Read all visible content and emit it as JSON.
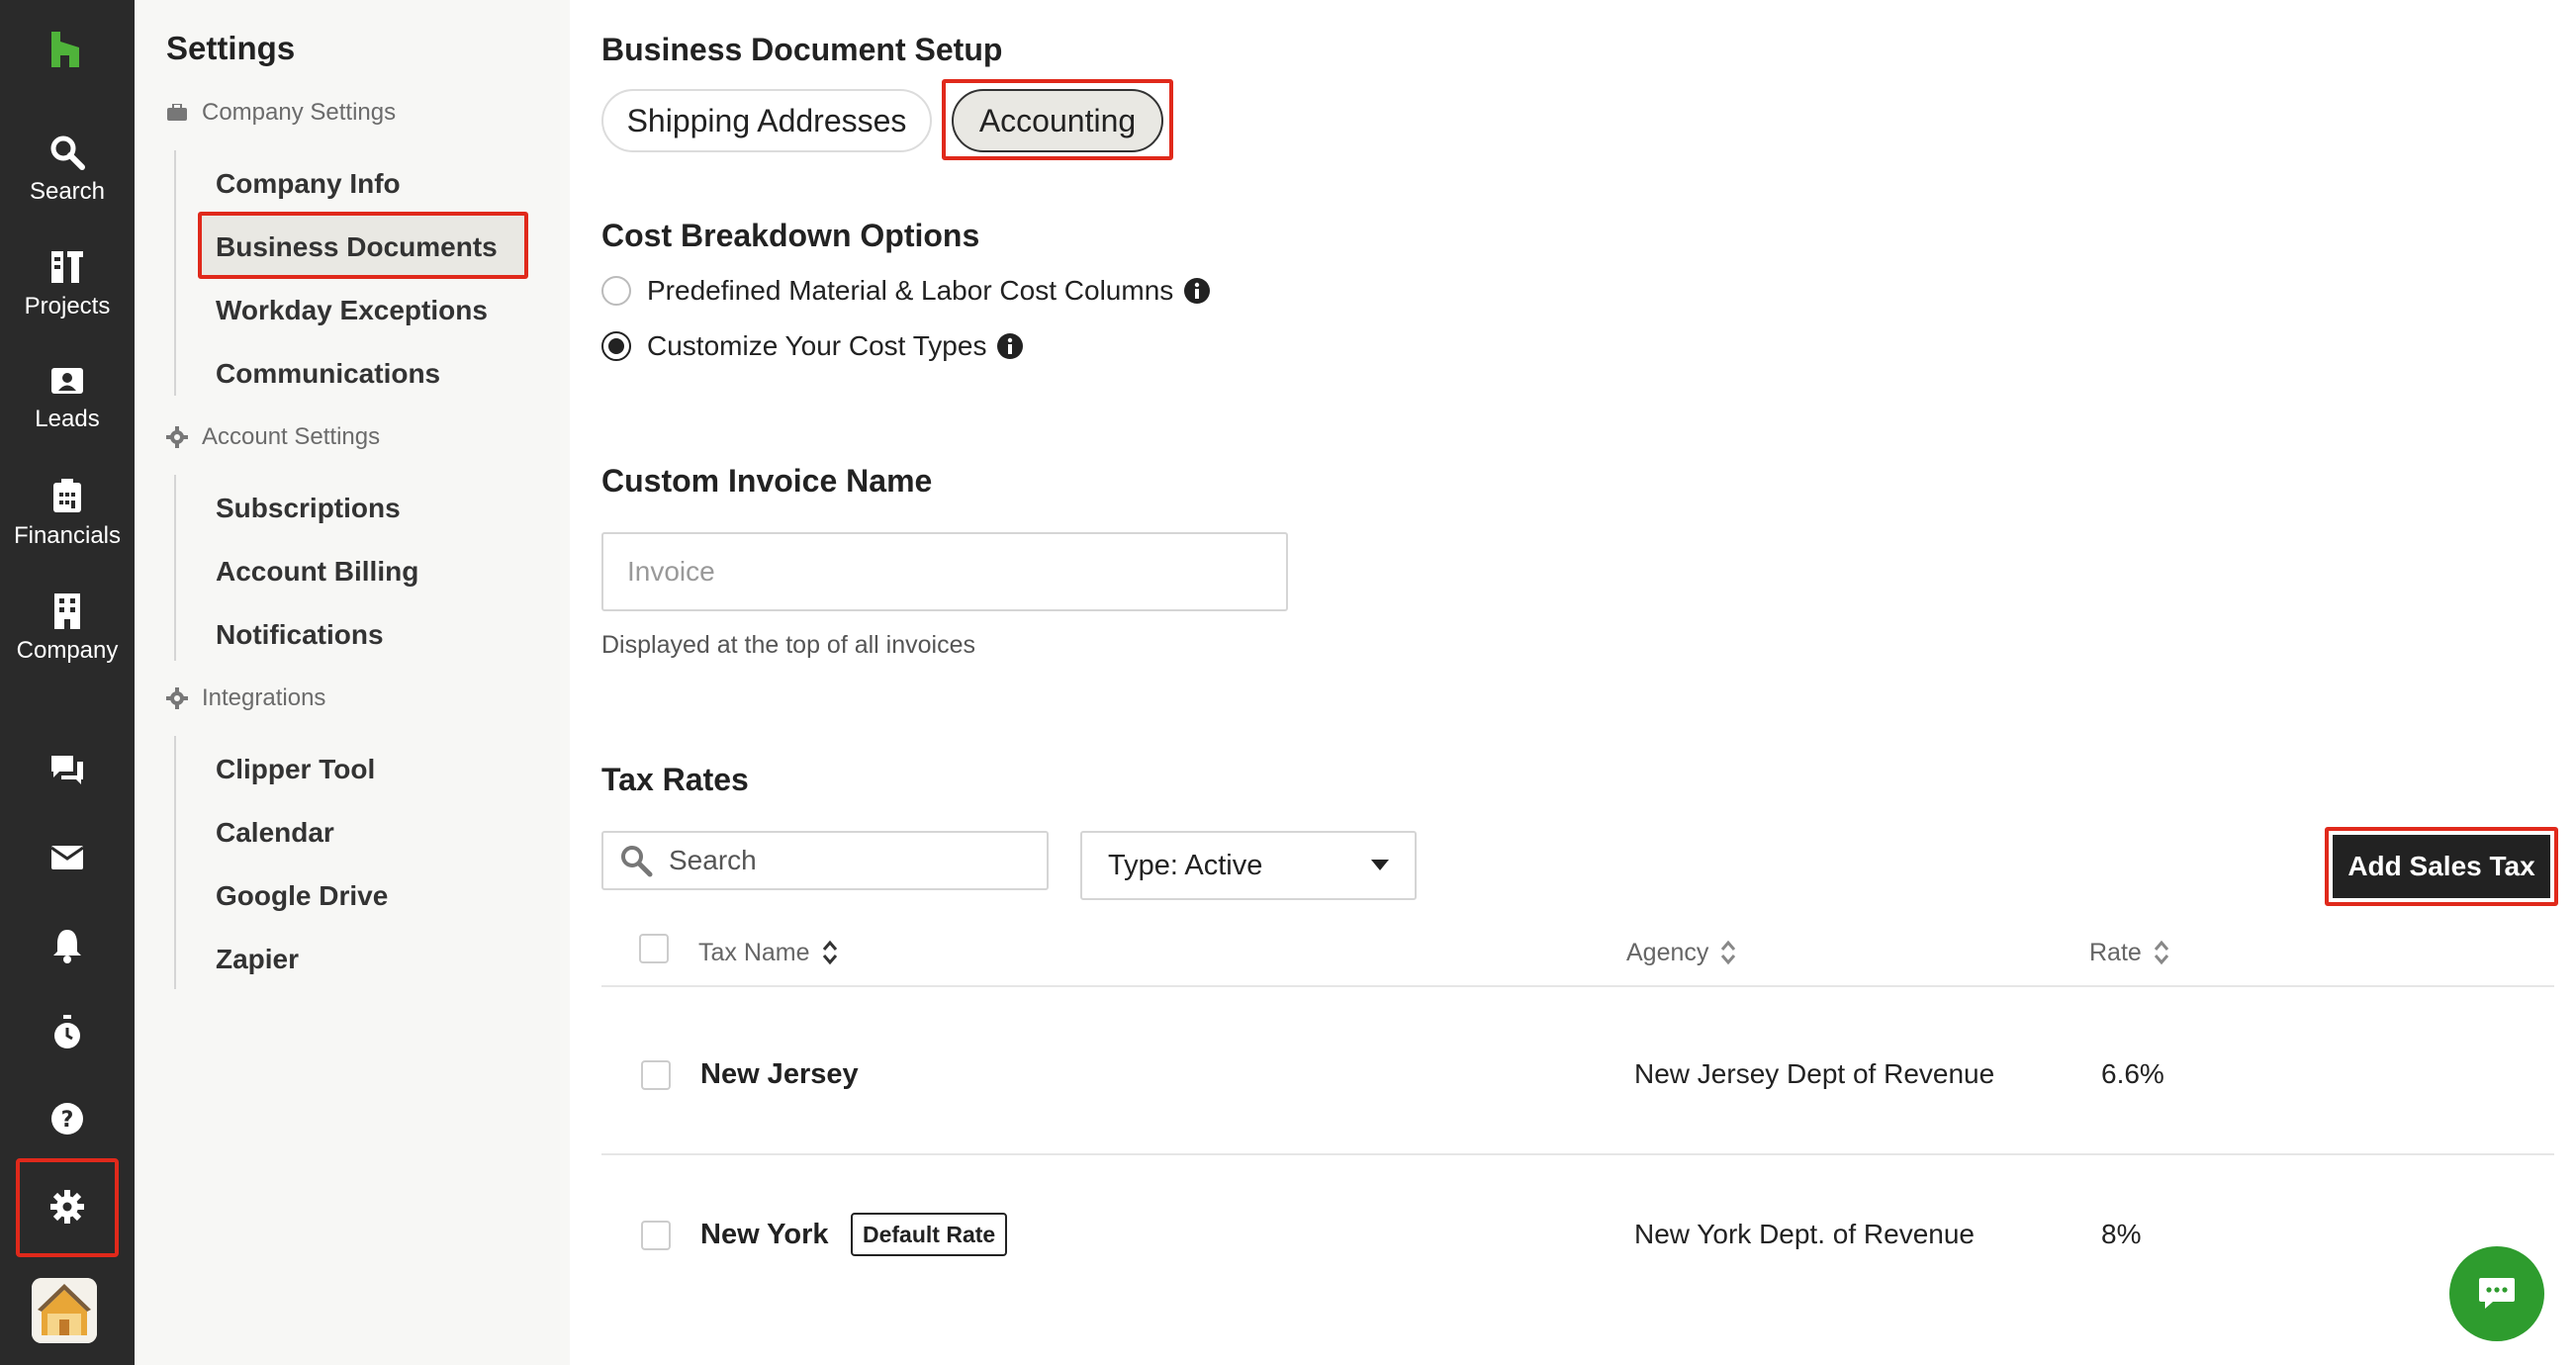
{
  "rail": {
    "items": [
      {
        "label": "Search"
      },
      {
        "label": "Projects"
      },
      {
        "label": "Leads"
      },
      {
        "label": "Financials"
      },
      {
        "label": "Company"
      }
    ]
  },
  "sidebar": {
    "title": "Settings",
    "groups": [
      {
        "header": "Company Settings",
        "items": [
          "Company Info",
          "Business Documents",
          "Workday Exceptions",
          "Communications"
        ]
      },
      {
        "header": "Account Settings",
        "items": [
          "Subscriptions",
          "Account Billing",
          "Notifications"
        ]
      },
      {
        "header": "Integrations",
        "items": [
          "Clipper Tool",
          "Calendar",
          "Google Drive",
          "Zapier"
        ]
      }
    ],
    "active_item": "Business Documents"
  },
  "main": {
    "setup_title": "Business Document Setup",
    "tabs": [
      {
        "label": "Shipping Addresses",
        "active": false
      },
      {
        "label": "Accounting",
        "active": true
      }
    ],
    "cost_breakdown": {
      "title": "Cost Breakdown Options",
      "options": [
        {
          "label": "Predefined Material & Labor Cost Columns",
          "checked": false
        },
        {
          "label": "Customize Your Cost Types",
          "checked": true
        }
      ]
    },
    "invoice": {
      "title": "Custom Invoice Name",
      "placeholder": "Invoice",
      "helper": "Displayed at the top of all invoices"
    },
    "tax_rates": {
      "title": "Tax Rates",
      "search_placeholder": "Search",
      "type_filter": "Type: Active",
      "add_button": "Add Sales Tax",
      "columns": {
        "name": "Tax Name",
        "agency": "Agency",
        "rate": "Rate"
      },
      "rows": [
        {
          "name": "New Jersey",
          "agency": "New Jersey Dept of Revenue",
          "rate": "6.6%",
          "badge": ""
        },
        {
          "name": "New York",
          "agency": "New York Dept. of Revenue",
          "rate": "8%",
          "badge": "Default Rate"
        }
      ]
    }
  },
  "colors": {
    "rail_bg": "#2a2a2a",
    "brand_green": "#4fb33a",
    "highlight_red": "#e0291b",
    "chat_green": "#2e9c2e"
  }
}
